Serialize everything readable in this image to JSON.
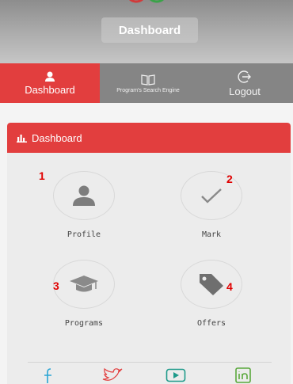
{
  "header": {
    "title": "Dashboard"
  },
  "nav": {
    "items": [
      {
        "label": "Dashboard",
        "icon": "user-icon",
        "active": true
      },
      {
        "label": "Program's Search Engine",
        "icon": "book-icon",
        "active": false
      },
      {
        "label": "Logout",
        "icon": "logout-icon",
        "active": false
      }
    ]
  },
  "card": {
    "title": "Dashboard",
    "tiles": [
      {
        "label": "Profile",
        "icon": "user-icon",
        "number": "1"
      },
      {
        "label": "Mark",
        "icon": "check-icon",
        "number": "2"
      },
      {
        "label": "Programs",
        "icon": "graduation-cap-icon",
        "number": "3"
      },
      {
        "label": "Offers",
        "icon": "tag-icon",
        "number": "4"
      }
    ]
  },
  "social": [
    {
      "icon": "facebook-icon"
    },
    {
      "icon": "twitter-icon"
    },
    {
      "icon": "youtube-icon"
    },
    {
      "icon": "linkedin-icon"
    }
  ],
  "colors": {
    "accent": "#e23e3e",
    "nav_bg": "#858585",
    "icon_gray": "#7d7d7d",
    "social_blue": "#2aa5d4"
  }
}
